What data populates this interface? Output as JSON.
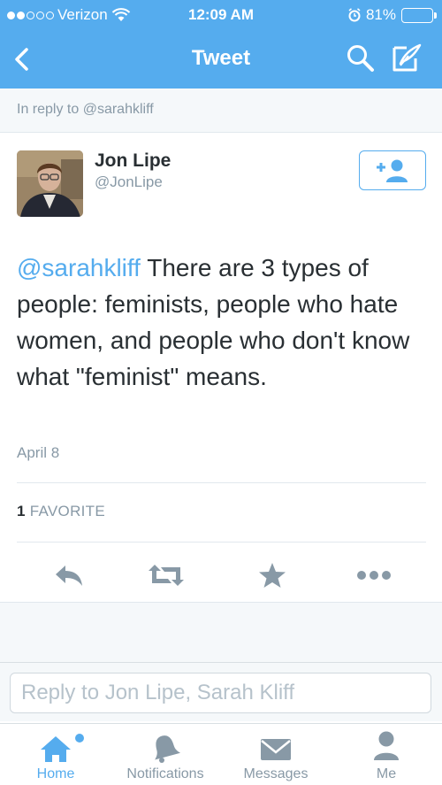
{
  "status_bar": {
    "carrier": "Verizon",
    "time": "12:09 AM",
    "battery": "81%",
    "battery_level": 0.81
  },
  "nav": {
    "title": "Tweet",
    "icons": [
      "chevron-left-icon",
      "search-icon",
      "compose-icon"
    ]
  },
  "in_reply": "In reply to @sarahkliff",
  "tweet": {
    "author_name": "Jon Lipe",
    "author_handle": "@JonLipe",
    "mention": "@sarahkliff",
    "body": " There are 3 types of people: feminists, people who hate women, and people who don't know what \"feminist\" means.",
    "date": "April 8",
    "favorite_count": "1",
    "favorite_label": "FAVORITE"
  },
  "actions": [
    "reply-icon",
    "retweet-icon",
    "favorite-icon",
    "more-icon"
  ],
  "reply_input": {
    "placeholder": "Reply to Jon Lipe, Sarah Kliff",
    "value": ""
  },
  "tabs": [
    {
      "label": "Home",
      "icon": "home-icon",
      "active": true
    },
    {
      "label": "Notifications",
      "icon": "bell-icon",
      "active": false
    },
    {
      "label": "Messages",
      "icon": "envelope-icon",
      "active": false
    },
    {
      "label": "Me",
      "icon": "person-icon",
      "active": false
    }
  ],
  "colors": {
    "brand": "#55acee",
    "text": "#292f33",
    "secondary_text": "#8899a6",
    "icon_gray": "#8899a6",
    "background_gray": "#f5f8fa"
  }
}
